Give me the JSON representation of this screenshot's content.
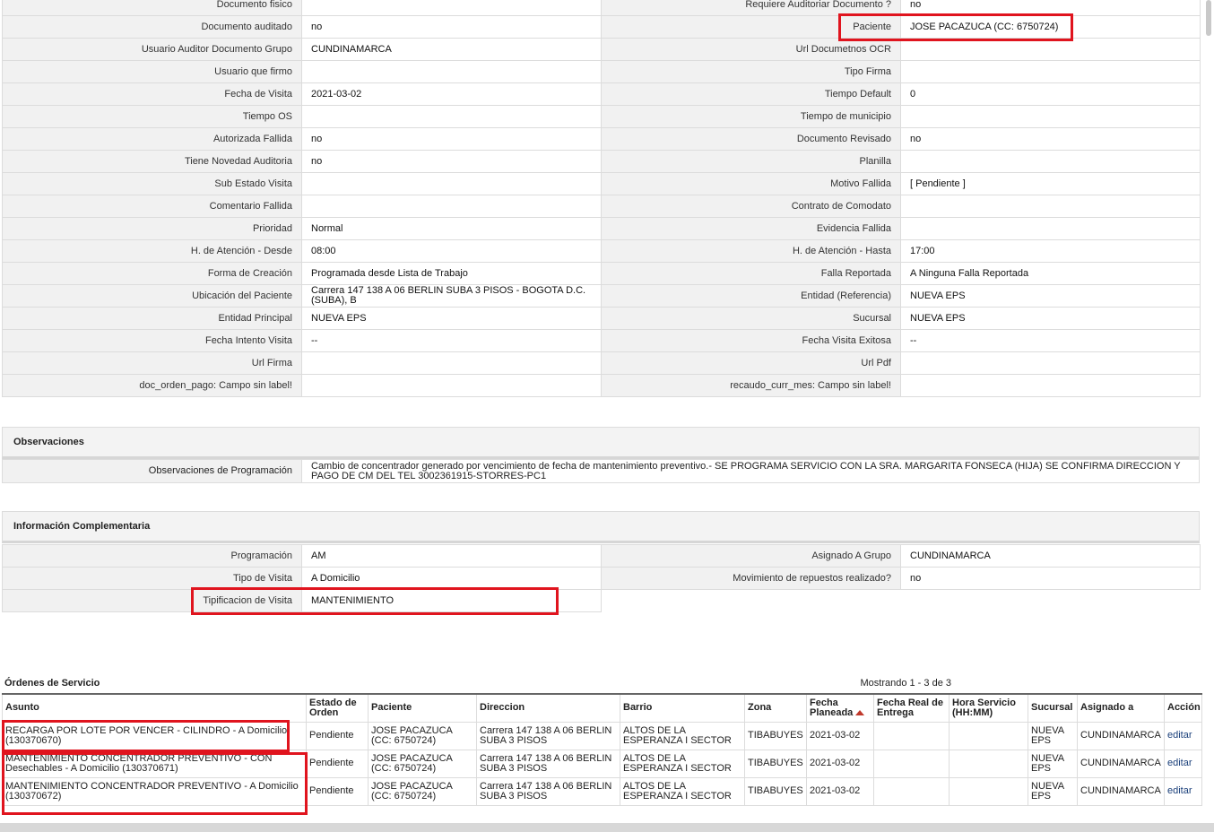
{
  "main_rows": [
    [
      "Documento fisico",
      "",
      "Requiere Auditoriar Documento ?",
      "no"
    ],
    [
      "Documento auditado",
      "no",
      "Paciente",
      "JOSE PACAZUCA (CC: 6750724)"
    ],
    [
      "Usuario Auditor Documento Grupo",
      "CUNDINAMARCA",
      "Url Documetnos OCR",
      ""
    ],
    [
      "Usuario que firmo",
      "",
      "Tipo Firma",
      ""
    ],
    [
      "Fecha de Visita",
      "2021-03-02",
      "Tiempo Default",
      "0"
    ],
    [
      "Tiempo OS",
      "",
      "Tiempo de municipio",
      ""
    ],
    [
      "Autorizada Fallida",
      "no",
      "Documento Revisado",
      "no"
    ],
    [
      "Tiene Novedad Auditoria",
      "no",
      "Planilla",
      ""
    ],
    [
      "Sub Estado Visita",
      "",
      "Motivo Fallida",
      "[ Pendiente ]"
    ],
    [
      "Comentario Fallida",
      "",
      "Contrato de Comodato",
      ""
    ],
    [
      "Prioridad",
      "Normal",
      "Evidencia Fallida",
      ""
    ],
    [
      "H. de Atención - Desde",
      "08:00",
      "H. de Atención - Hasta",
      "17:00"
    ],
    [
      "Forma de Creación",
      "Programada desde Lista de Trabajo",
      "Falla Reportada",
      "A Ninguna Falla Reportada"
    ],
    [
      "Ubicación del Paciente",
      "Carrera 147 138 A 06 BERLIN SUBA 3 PISOS - BOGOTA D.C. (SUBA), B",
      "Entidad (Referencia)",
      "NUEVA EPS"
    ],
    [
      "Entidad Principal",
      "NUEVA EPS",
      "Sucursal",
      "NUEVA EPS"
    ],
    [
      "Fecha Intento Visita",
      "--",
      "Fecha Visita Exitosa",
      "--"
    ],
    [
      "Url Firma",
      "",
      "Url Pdf",
      ""
    ],
    [
      "doc_orden_pago: Campo sin label!",
      "",
      "recaudo_curr_mes: Campo sin label!",
      ""
    ]
  ],
  "observaciones": {
    "title": "Observaciones",
    "label": "Observaciones de Programación",
    "value": "  Cambio de concentrador generado por vencimiento de fecha de mantenimiento preventivo.- SE PROGRAMA SERVICIO CON LA SRA. MARGARITA FONSECA (HIJA) SE CONFIRMA DIRECCION Y PAGO DE CM DEL TEL 3002361915-STORRES-PC1"
  },
  "complementaria": {
    "title": "Información Complementaria",
    "rows": [
      [
        "Programación",
        "AM",
        "Asignado A Grupo",
        "CUNDINAMARCA"
      ],
      [
        "Tipo de Visita",
        "A Domicilio",
        "Movimiento de repuestos realizado?",
        "no"
      ],
      [
        "Tipificacion de Visita",
        "MANTENIMIENTO",
        "",
        ""
      ]
    ]
  },
  "orders": {
    "title": "Órdenes de Servicio",
    "count_text": "Mostrando 1 - 3 de 3",
    "columns": [
      "Asunto",
      "Estado de Orden",
      "Paciente",
      "Direccion",
      "Barrio",
      "Zona",
      "Fecha Planeada",
      "Fecha Real de Entrega",
      "Hora Servicio (HH:MM)",
      "Sucursal",
      "Asignado a",
      "Acción"
    ],
    "rows": [
      {
        "asunto": "RECARGA POR LOTE POR VENCER - CILINDRO - A Domicilio (130370670)",
        "estado": "Pendiente",
        "paciente": "JOSE PACAZUCA (CC: 6750724)",
        "direccion": "Carrera 147 138 A 06 BERLIN SUBA 3 PISOS",
        "barrio": "ALTOS DE LA ESPERANZA I SECTOR",
        "zona": "TIBABUYES",
        "fecha_planeada": "2021-03-02",
        "fecha_real": "",
        "hora": "",
        "sucursal": "NUEVA EPS",
        "asignado": "CUNDINAMARCA",
        "accion": "editar"
      },
      {
        "asunto": "MANTENIMIENTO CONCENTRADOR PREVENTIVO - CON Desechables - A Domicilio (130370671)",
        "estado": "Pendiente",
        "paciente": "JOSE PACAZUCA (CC: 6750724)",
        "direccion": "Carrera 147 138 A 06 BERLIN SUBA 3 PISOS",
        "barrio": "ALTOS DE LA ESPERANZA I SECTOR",
        "zona": "TIBABUYES",
        "fecha_planeada": "2021-03-02",
        "fecha_real": "",
        "hora": "",
        "sucursal": "NUEVA EPS",
        "asignado": "CUNDINAMARCA",
        "accion": "editar"
      },
      {
        "asunto": "MANTENIMIENTO CONCENTRADOR PREVENTIVO - A Domicilio (130370672)",
        "estado": "Pendiente",
        "paciente": "JOSE PACAZUCA (CC: 6750724)",
        "direccion": "Carrera 147 138 A 06 BERLIN SUBA 3 PISOS",
        "barrio": "ALTOS DE LA ESPERANZA I SECTOR",
        "zona": "TIBABUYES",
        "fecha_planeada": "2021-03-02",
        "fecha_real": "",
        "hora": "",
        "sucursal": "NUEVA EPS",
        "asignado": "CUNDINAMARCA",
        "accion": "editar"
      }
    ]
  },
  "colors": {
    "highlight_border": "#e0141e",
    "label_background": "#f1f1f1",
    "link": "#1a3f7a",
    "sort_arrow": "#c0392b"
  }
}
